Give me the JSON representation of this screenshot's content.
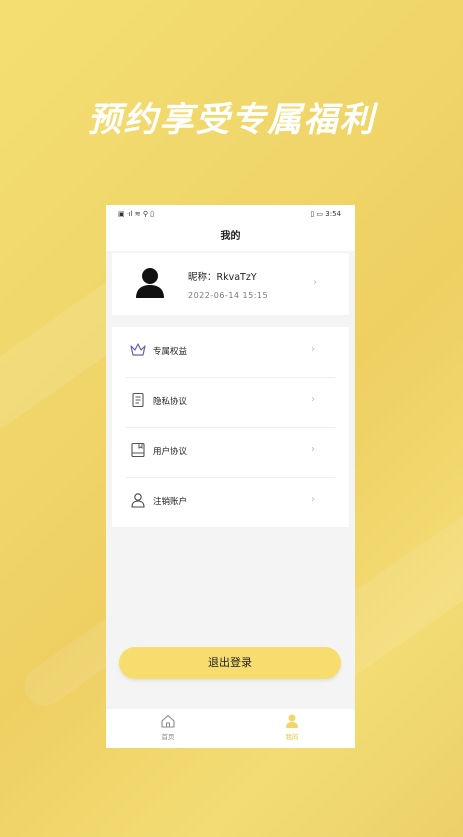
{
  "promo": {
    "headline": "预约享受专属福利"
  },
  "status_bar": {
    "left_icons": "▣ ᐧıl ≋ ⚲ ▯",
    "battery_text": "▭",
    "time": "3:54"
  },
  "header": {
    "title": "我的"
  },
  "profile": {
    "nickname": "昵称：RkvaTzY",
    "registered": "2022-06-14 15:15"
  },
  "menu": {
    "items": [
      {
        "label": "专属权益",
        "icon": "crown-icon"
      },
      {
        "label": "隐私协议",
        "icon": "document-icon"
      },
      {
        "label": "用户协议",
        "icon": "book-icon"
      },
      {
        "label": "注销账户",
        "icon": "user-icon"
      }
    ]
  },
  "logout": {
    "label": "退出登录"
  },
  "tabbar": {
    "tabs": [
      {
        "label": "首页",
        "icon": "home-icon",
        "active": false
      },
      {
        "label": "我的",
        "icon": "profile-icon",
        "active": true
      }
    ]
  },
  "colors": {
    "background": "#f0d66a",
    "accent": "#f7dd6e",
    "active_tab": "#e8c94a",
    "icon_purple": "#6a5fb0"
  }
}
